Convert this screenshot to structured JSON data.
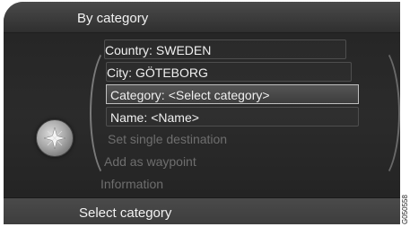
{
  "header": {
    "title": "By category"
  },
  "menu": {
    "country": {
      "label": "Country:",
      "value": "SWEDEN"
    },
    "city": {
      "label": "City:",
      "value": "GÖTEBORG"
    },
    "category": {
      "label": "Category:",
      "value": "<Select category>"
    },
    "name": {
      "label": "Name:",
      "value": "<Name>"
    },
    "set_single_destination": "Set single destination",
    "add_as_waypoint": "Add as waypoint",
    "information": "Information"
  },
  "footer": {
    "title": "Select category"
  },
  "image_code": "G050558",
  "icons": {
    "knob": "navigation-knob-icon"
  },
  "colors": {
    "background": "#2a2a2a",
    "text": "#f0f0f0",
    "disabled_text": "#6e6e6e",
    "highlight_border": "#bfbfbf"
  }
}
